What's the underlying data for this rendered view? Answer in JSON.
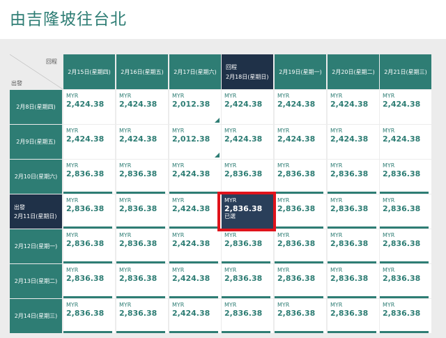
{
  "page_title": "由吉隆坡往台北",
  "corner": {
    "return_label": "回程",
    "depart_label": "出發"
  },
  "selected_tag": "回程",
  "depart_selected_tag": "出發",
  "return_dates": [
    "2月15日(星期四)",
    "2月16日(星期五)",
    "2月17日(星期六)",
    "2月18日(星期日)",
    "2月19日(星期一)",
    "2月20日(星期二)",
    "2月21日(星期三)"
  ],
  "depart_dates": [
    "2月8日(星期四)",
    "2月9日(星期五)",
    "2月10日(星期六)",
    "2月11日(星期日)",
    "2月12日(星期一)",
    "2月13日(星期二)",
    "2月14日(星期三)"
  ],
  "currency": "MYR",
  "sold_label": "已選",
  "prices": [
    [
      "2,424.38",
      "2,424.38",
      "2,012.38",
      "2,424.38",
      "2,424.38",
      "2,424.38",
      "2,424.38"
    ],
    [
      "2,424.38",
      "2,424.38",
      "2,012.38",
      "2,424.38",
      "2,424.38",
      "2,424.38",
      "2,424.38"
    ],
    [
      "2,836.38",
      "2,836.38",
      "2,424.38",
      "2,836.38",
      "2,836.38",
      "2,836.38",
      "2,836.38"
    ],
    [
      "2,836.38",
      "2,836.38",
      "2,424.38",
      "2,836.38",
      "2,836.38",
      "2,836.38",
      "2,836.38"
    ],
    [
      "2,836.38",
      "2,836.38",
      "2,424.38",
      "2,836.38",
      "2,836.38",
      "2,836.38",
      "2,836.38"
    ],
    [
      "2,836.38",
      "2,836.38",
      "2,424.38",
      "2,836.38",
      "2,836.38",
      "2,836.38",
      "2,836.38"
    ],
    [
      "2,836.38",
      "2,836.38",
      "2,424.38",
      "2,836.38",
      "2,836.38",
      "2,836.38",
      "2,836.38"
    ]
  ],
  "selected_return_index": 3,
  "selected_depart_index": 3,
  "colors": {
    "teal": "#2e7d74",
    "navy": "#1f3148",
    "highlight": "#e0131b"
  }
}
